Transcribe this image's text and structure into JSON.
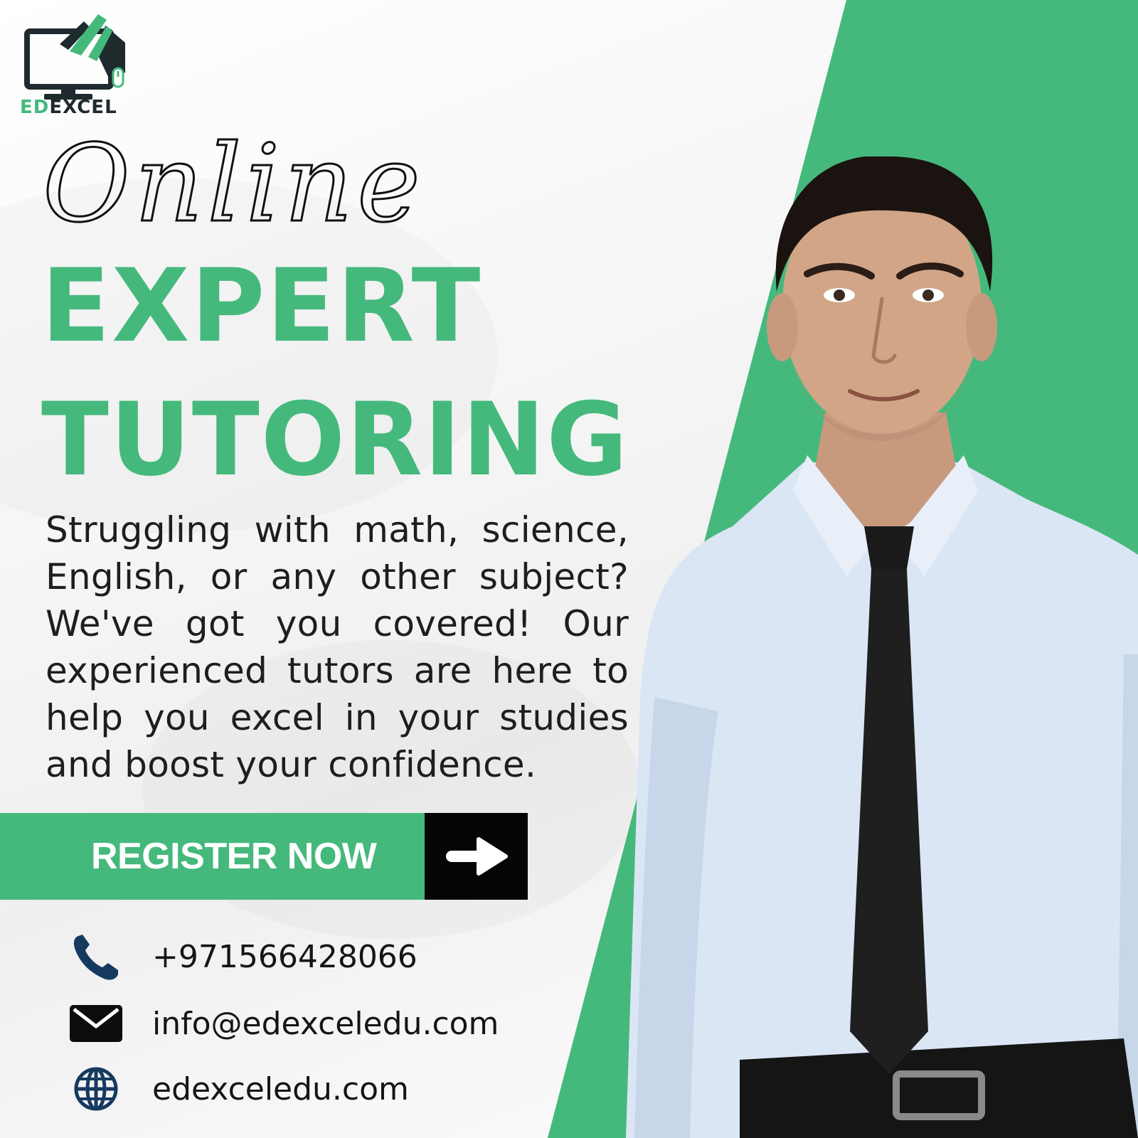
{
  "brand": {
    "logo_prefix": "ED",
    "logo_suffix": "EXCEL",
    "accent_color": "#45b97c",
    "dark_color": "#1f2a2e"
  },
  "hero": {
    "script_word": "Online",
    "headline_line1": "EXPERT",
    "headline_line2": "TUTORING"
  },
  "description": "Struggling with math, science, English, or any other subject? We've got you covered! Our experienced tutors are here to help you excel in your studies and boost your confidence.",
  "cta": {
    "label": "REGISTER NOW",
    "icon": "arrow-right-icon"
  },
  "contacts": [
    {
      "icon": "phone-icon",
      "text": "+971566428066"
    },
    {
      "icon": "mail-icon",
      "text": "info@edexceledu.com"
    },
    {
      "icon": "globe-icon",
      "text": "edexceledu.com"
    }
  ]
}
